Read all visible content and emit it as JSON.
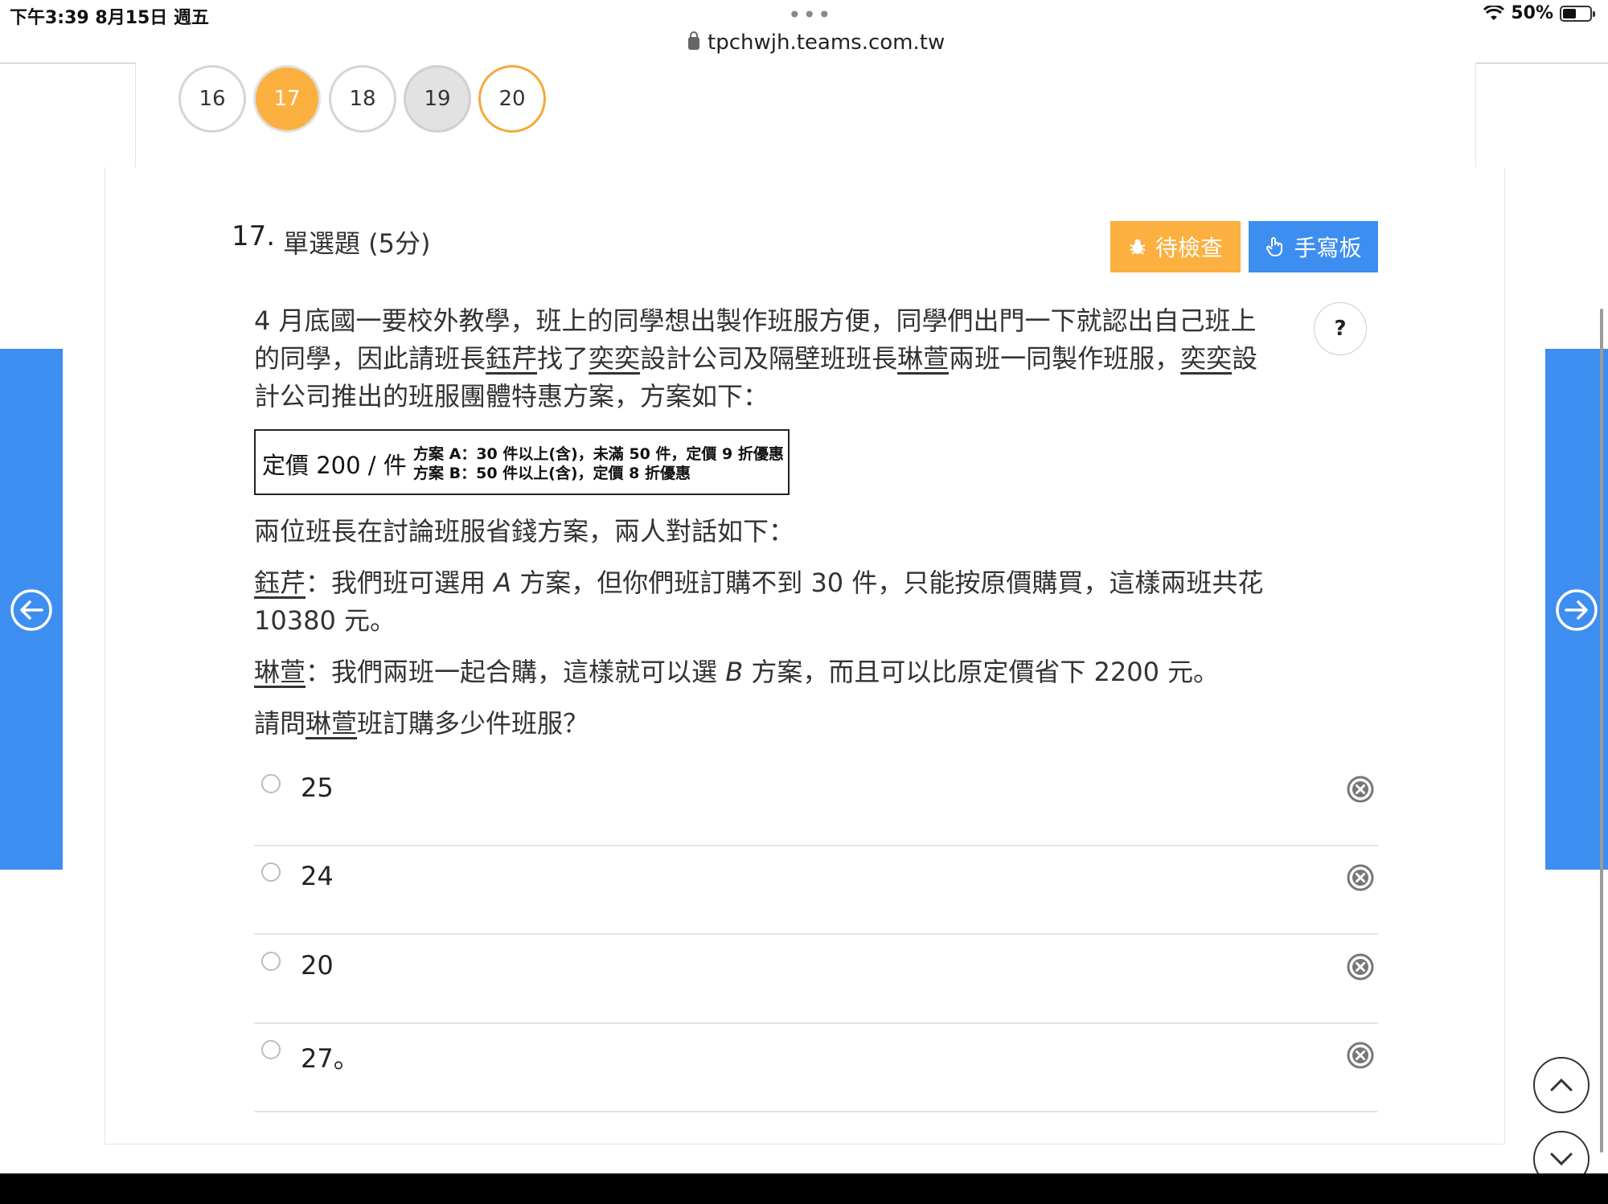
{
  "status_bar": {
    "time": "下午3:39   8月15日 週五",
    "dots": "•••",
    "url": "tpchwjh.teams.com.tw",
    "battery": "50%",
    "battery_level": 0.5
  },
  "question_nav": {
    "items": [
      {
        "label": "16",
        "state": "default"
      },
      {
        "label": "17",
        "state": "current"
      },
      {
        "label": "18",
        "state": "default"
      },
      {
        "label": "19",
        "state": "answered"
      },
      {
        "label": "20",
        "state": "flag"
      }
    ]
  },
  "question": {
    "number": "17.",
    "type": "單選題 (5分)",
    "review_button": "待檢查",
    "handwriting_button": "手寫板",
    "help_label": "?",
    "intro_1": "4 月底國一要校外教學，班上的同學想出製作班服方便，同學們出門一下就認出自己班上",
    "intro_2a": "的同學，因此請班長",
    "name_1": "鈺芹",
    "intro_2b": "找了",
    "company": "奕奕",
    "intro_2c": "設計公司及隔壁班班長",
    "name_2": "琳萱",
    "intro_2d": "兩班一同製作班服，",
    "intro_2e": "設",
    "intro_3": "計公司推出的班服團體特惠方案，方案如下：",
    "price_box": {
      "price": "定價 200 / 件",
      "plan_a": "方案 A：30 件以上(含)，未滿 50 件，定價 9 折優惠",
      "plan_b": "方案 B：50 件以上(含)，定價 8 折優惠"
    },
    "dialog_intro": "兩位班長在討論班服省錢方案，兩人對話如下：",
    "dialog_1a": "：我們班可選用 ",
    "dialog_1_plan": "A",
    "dialog_1b": " 方案，但你們班訂購不到 30 件，只能按原價購買，這樣兩班共花",
    "dialog_1c": "10380 元。",
    "dialog_2a": "：我們兩班一起合購，這樣就可以選 ",
    "dialog_2_plan": "B",
    "dialog_2b": " 方案，而且可以比原定價省下 2200 元。",
    "ask_a": "請問",
    "ask_b": "班訂購多少件班服？",
    "options": [
      {
        "label": "25"
      },
      {
        "label": "24"
      },
      {
        "label": "20"
      },
      {
        "label": "27。"
      }
    ]
  },
  "colors": {
    "accent_blue": "#3d8ef0",
    "accent_orange": "#fbb040"
  },
  "icons": {
    "review": "bug-icon",
    "handwriting": "hand-pointer-icon",
    "prev": "arrow-left-circle-icon",
    "next": "arrow-right-circle-icon",
    "scroll_up": "chevron-up-icon",
    "scroll_down": "chevron-down-icon",
    "remove": "x-circle-icon"
  }
}
